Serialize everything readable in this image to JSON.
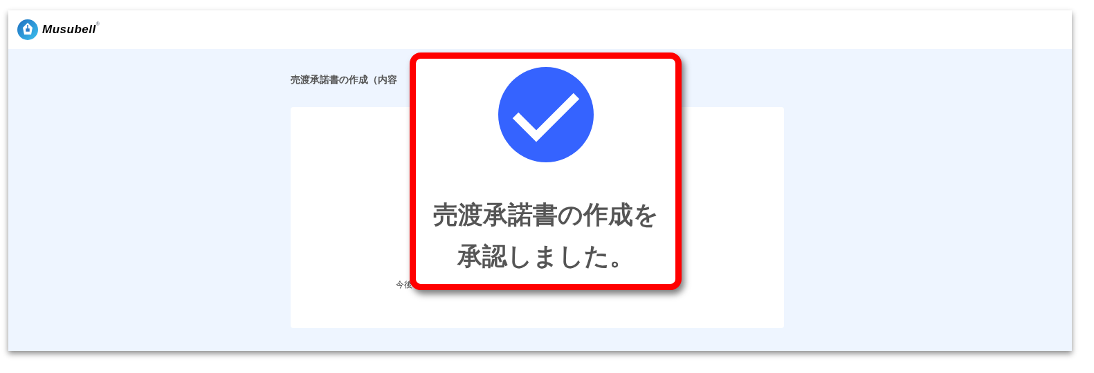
{
  "header": {
    "brand": "Musubell",
    "brand_mark": "®"
  },
  "page": {
    "title": "売渡承諾書の作成（内容",
    "note": "今後"
  },
  "callout": {
    "message_lines": [
      "売渡承諾書の作成を",
      "承認しました。"
    ]
  }
}
